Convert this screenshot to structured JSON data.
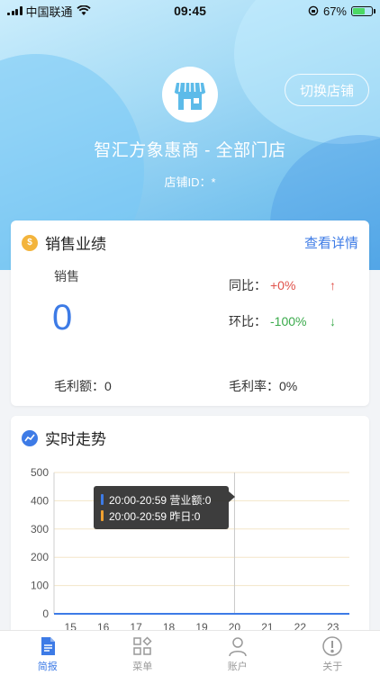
{
  "status": {
    "carrier": "中国联通",
    "time": "09:45",
    "battery": "67%",
    "battery_level": 0.67
  },
  "store": {
    "name": "智汇方象惠商 - 全部门店",
    "id_label": "店铺ID：",
    "id_value": "*",
    "switch_label": "切换店铺"
  },
  "sales_card": {
    "title": "销售业绩",
    "detail_link": "查看详情",
    "sales_label": "销售",
    "sales_value": "0",
    "yoy_label": "同比：",
    "yoy_value": "+0%",
    "mom_label": "环比：",
    "mom_value": "-100%",
    "gross_label": "毛利额：",
    "gross_value": "0",
    "gross_rate_label": "毛利率：",
    "gross_rate_value": "0%"
  },
  "trend_card": {
    "title": "实时走势",
    "tooltip": {
      "row1": "20:00-20:59 营业额:0",
      "row2": "20:00-20:59 昨日:0"
    }
  },
  "chart_data": {
    "type": "line",
    "x": [
      15,
      16,
      17,
      18,
      19,
      20,
      21,
      22,
      23
    ],
    "ylim": [
      0,
      500
    ],
    "yticks": [
      0,
      100,
      200,
      300,
      400,
      500
    ],
    "grid": true,
    "series": [
      {
        "name": "营业额",
        "color": "#3d7be6",
        "values": [
          0,
          0,
          0,
          0,
          0,
          0,
          0,
          0,
          0
        ]
      },
      {
        "name": "昨日",
        "color": "#f0a030",
        "values": [
          0,
          0,
          0,
          0,
          0,
          0,
          0,
          0,
          0
        ]
      }
    ],
    "highlight_x": 20
  },
  "tabs": [
    {
      "label": "简报",
      "icon": "report-icon",
      "active": true
    },
    {
      "label": "菜单",
      "icon": "menu-grid-icon",
      "active": false
    },
    {
      "label": "账户",
      "icon": "account-icon",
      "active": false
    },
    {
      "label": "关于",
      "icon": "info-icon",
      "active": false
    }
  ]
}
